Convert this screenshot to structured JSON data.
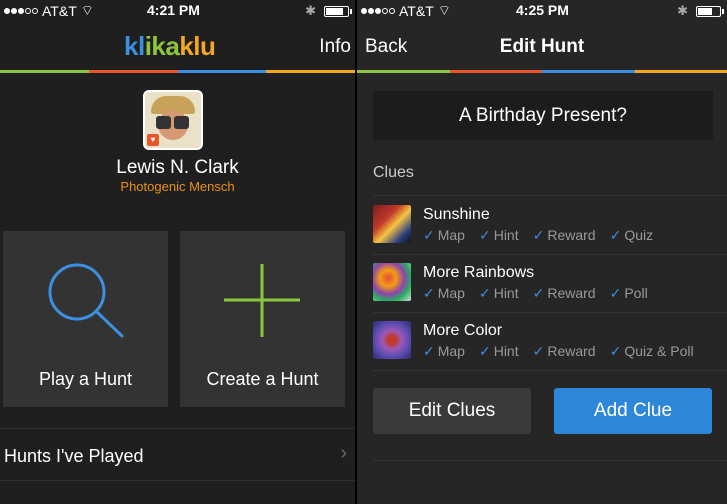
{
  "left": {
    "status": {
      "carrier": "AT&T",
      "time": "4:21 PM"
    },
    "nav": {
      "logo_parts": [
        "kl",
        "ika",
        "klu"
      ],
      "info_label": "Info"
    },
    "profile": {
      "name": "Lewis N. Clark",
      "subtitle": "Photogenic Mensch"
    },
    "tiles": {
      "play": "Play a Hunt",
      "create": "Create a Hunt"
    },
    "list": {
      "played_label": "Hunts I've Played"
    }
  },
  "right": {
    "status": {
      "carrier": "AT&T",
      "time": "4:25 PM"
    },
    "nav": {
      "back_label": "Back",
      "title": "Edit Hunt"
    },
    "hunt_title": "A Birthday Present?",
    "section_label": "Clues",
    "clues": [
      {
        "title": "Sunshine",
        "tags": [
          "Map",
          "Hint",
          "Reward",
          "Quiz"
        ]
      },
      {
        "title": "More Rainbows",
        "tags": [
          "Map",
          "Hint",
          "Reward",
          "Poll"
        ]
      },
      {
        "title": "More Color",
        "tags": [
          "Map",
          "Hint",
          "Reward",
          "Quiz & Poll"
        ]
      }
    ],
    "buttons": {
      "edit_clues": "Edit Clues",
      "add_clue": "Add Clue"
    }
  },
  "colors": {
    "blue": "#3d8fe0",
    "green": "#8cc63f",
    "orange": "#f5a623",
    "red": "#e8572b",
    "subtitle_orange": "#e8911c",
    "button_blue": "#2d86d8"
  },
  "icons": {
    "search": "magnifier-icon",
    "create": "plus-icon",
    "chevron": "chevron-right-icon",
    "check": "checkmark-icon"
  }
}
